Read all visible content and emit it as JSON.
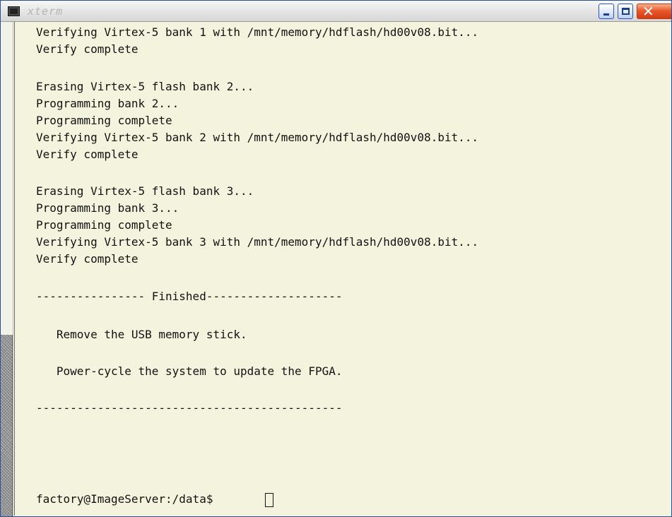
{
  "window": {
    "title": "xterm"
  },
  "titlebar": {
    "controls": [
      {
        "name": "minimize",
        "icon": "minimize-icon"
      },
      {
        "name": "maximize",
        "icon": "maximize-icon"
      },
      {
        "name": "close",
        "icon": "close-icon"
      }
    ]
  },
  "terminal": {
    "lines": [
      "Verifying Virtex-5 bank 1 with /mnt/memory/hdflash/hd00v08.bit...",
      "Verify complete",
      "Erasing Virtex-5 flash bank 2...",
      "Programming bank 2...",
      "Programming complete",
      "Verifying Virtex-5 bank 2 with /mnt/memory/hdflash/hd00v08.bit...",
      "Verify complete",
      "Erasing Virtex-5 flash bank 3...",
      "Programming bank 3...",
      "Programming complete",
      "Verifying Virtex-5 bank 3 with /mnt/memory/hdflash/hd00v08.bit...",
      "Verify complete",
      "---------------- Finished--------------------",
      "   Remove the USB memory stick.",
      "   Power-cycle the system to update the FPGA.",
      "---------------------------------------------",
      "factory@ImageServer:/data$"
    ]
  },
  "colors": {
    "terminal_background": "#f4f4de",
    "terminal_text": "#111111",
    "close_button": "#e9592e",
    "window_button": "#dfe8fb"
  }
}
